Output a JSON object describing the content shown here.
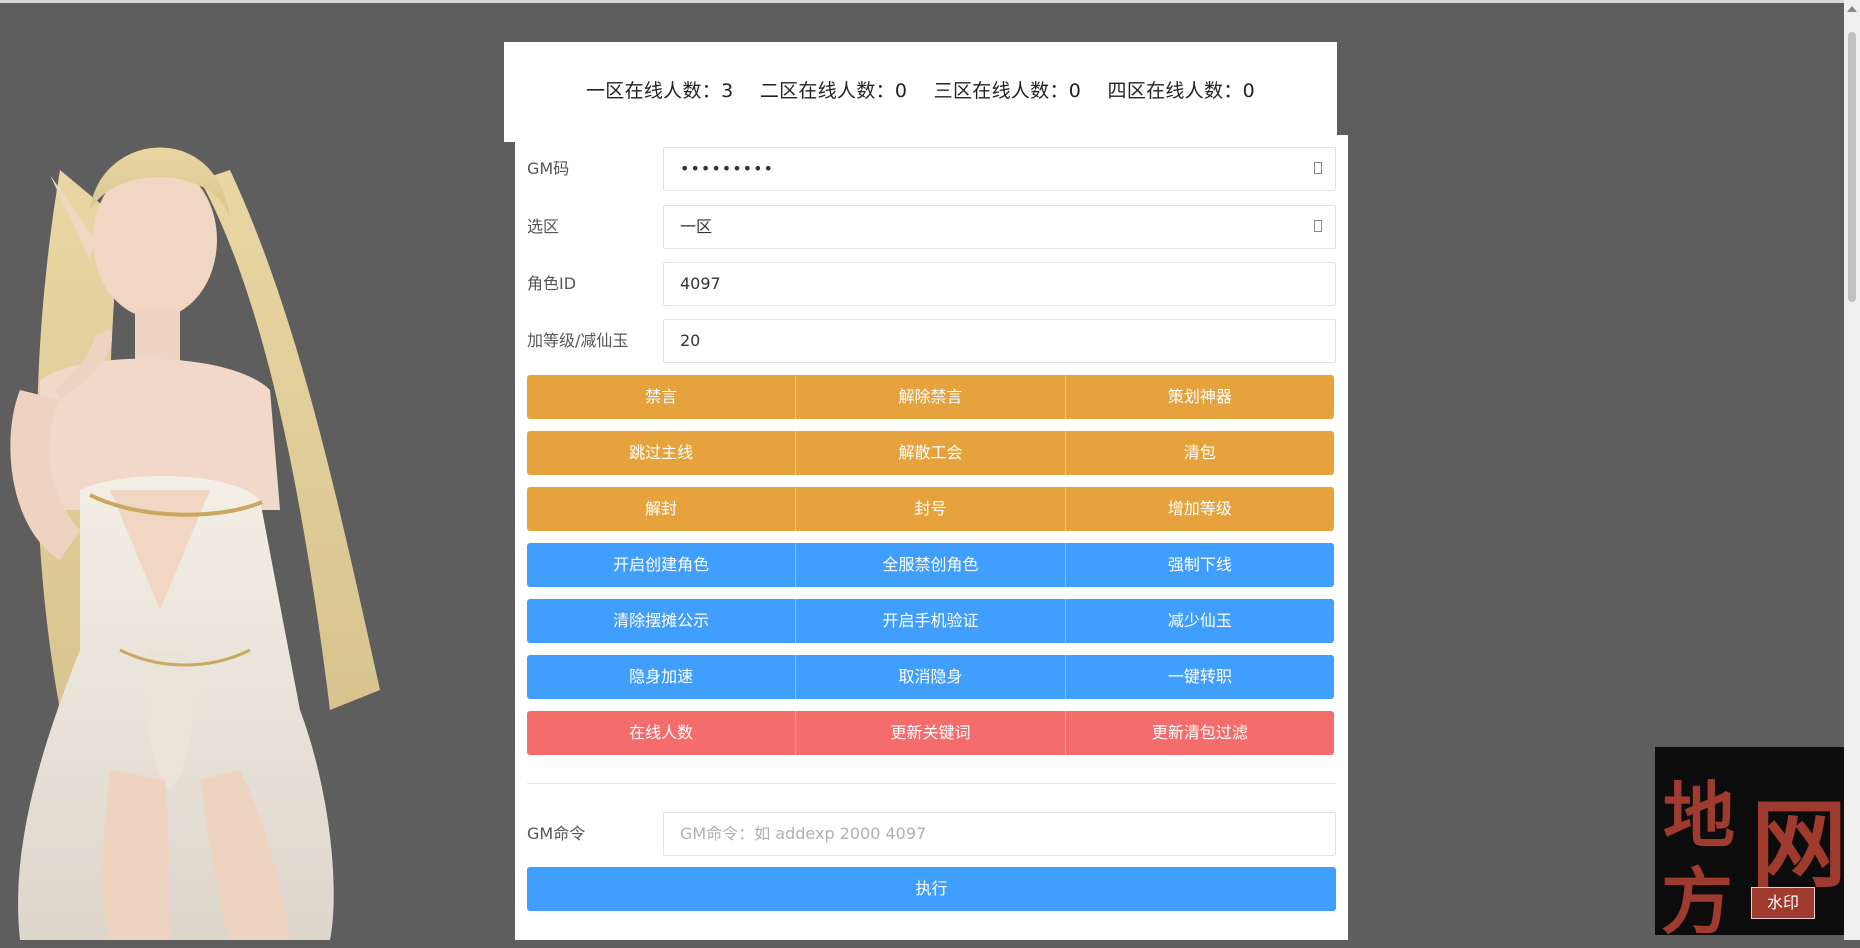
{
  "online": [
    {
      "label": "一区在线人数：3"
    },
    {
      "label": "二区在线人数：0"
    },
    {
      "label": "三区在线人数：0"
    },
    {
      "label": "四区在线人数：0"
    }
  ],
  "form": {
    "gm_code": {
      "label": "GM码",
      "value": "•••••••••"
    },
    "zone": {
      "label": "选区",
      "value": "一区"
    },
    "role_id": {
      "label": "角色ID",
      "value": "4097"
    },
    "amount": {
      "label": "加等级/减仙玉",
      "value": "20"
    }
  },
  "button_rows": [
    {
      "color": "#e6a23c",
      "buttons": [
        "禁言",
        "解除禁言",
        "策划神器"
      ]
    },
    {
      "color": "#e6a23c",
      "buttons": [
        "跳过主线",
        "解散工会",
        "清包"
      ]
    },
    {
      "color": "#e6a23c",
      "buttons": [
        "解封",
        "封号",
        "增加等级"
      ]
    },
    {
      "color": "#409eff",
      "buttons": [
        "开启创建角色",
        "全服禁创角色",
        "强制下线"
      ]
    },
    {
      "color": "#409eff",
      "buttons": [
        "清除摆摊公示",
        "开启手机验证",
        "减少仙玉"
      ]
    },
    {
      "color": "#409eff",
      "buttons": [
        "隐身加速",
        "取消隐身",
        "一键转职"
      ]
    },
    {
      "color": "#f56c6c",
      "buttons": [
        "在线人数",
        "更新关键词",
        "更新清包过滤"
      ]
    }
  ],
  "gm_command": {
    "label": "GM命令",
    "placeholder": "GM命令：如 addexp 2000 4097",
    "execute_label": "执行"
  },
  "watermark": {
    "chars": [
      "地",
      "方",
      "网"
    ],
    "stamp": "水印"
  }
}
